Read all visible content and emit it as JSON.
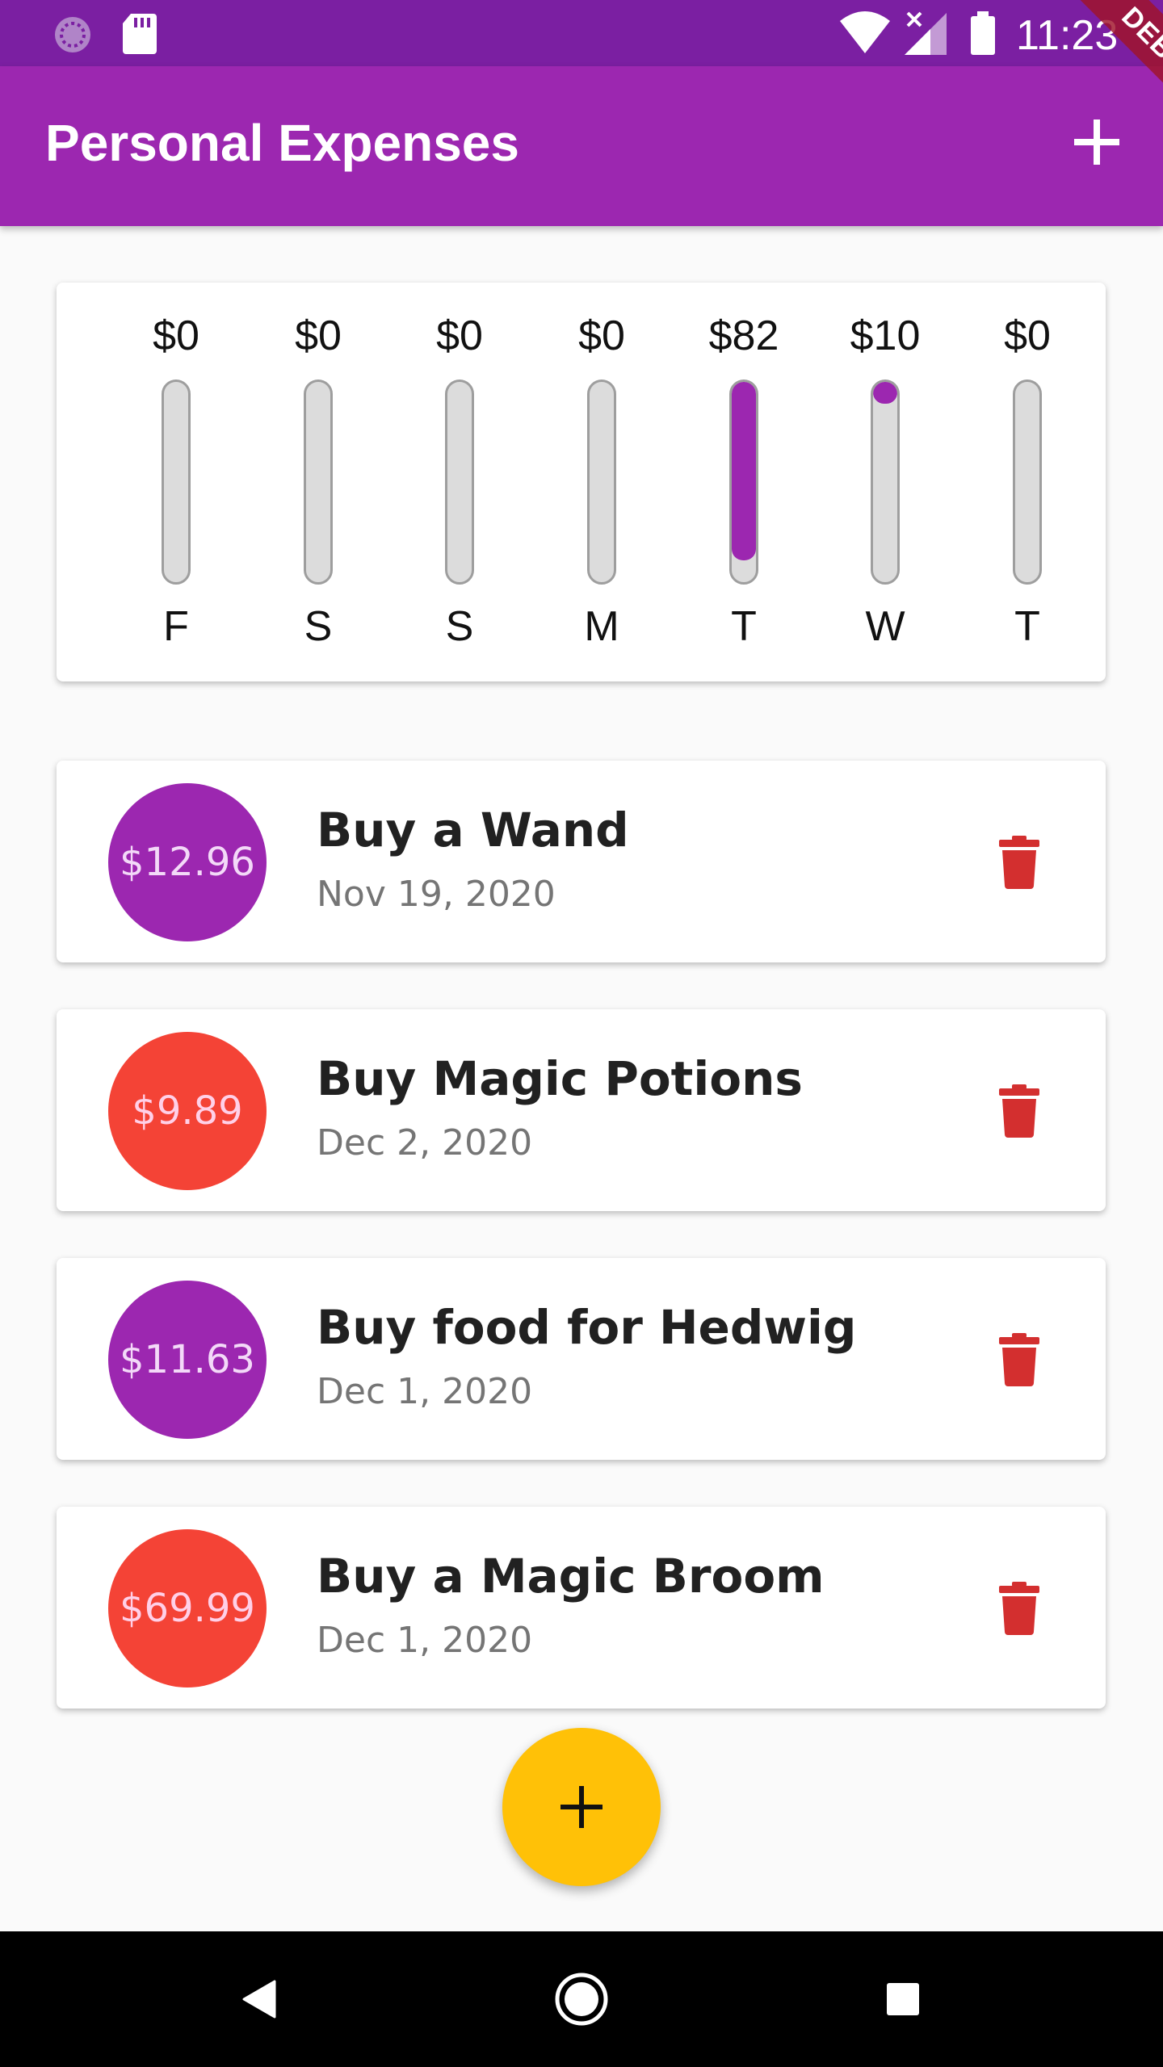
{
  "status_bar": {
    "time": "11:23",
    "icons": [
      "spinner-icon",
      "sd-card-icon",
      "wifi-icon",
      "signal-icon",
      "battery-icon"
    ]
  },
  "app_bar": {
    "title": "Personal Expenses",
    "add_icon": "plus-icon",
    "debug_banner": "DEBUG"
  },
  "colors": {
    "primary": "#9c27b0",
    "primary_dark": "#7b1fa2",
    "accent": "#ffc107",
    "avatar_alt": "#f44336",
    "delete": "#d32f2f"
  },
  "chart": {
    "days": [
      {
        "amount": "$0",
        "label": "F",
        "fill": 0
      },
      {
        "amount": "$0",
        "label": "S",
        "fill": 0
      },
      {
        "amount": "$0",
        "label": "S",
        "fill": 0
      },
      {
        "amount": "$0",
        "label": "M",
        "fill": 0
      },
      {
        "amount": "$82",
        "label": "T",
        "fill": 0.89
      },
      {
        "amount": "$10",
        "label": "W",
        "fill": 0.11
      },
      {
        "amount": "$0",
        "label": "T",
        "fill": 0
      }
    ]
  },
  "transactions": [
    {
      "amount": "$12.96",
      "title": "Buy a Wand",
      "date": "Nov 19, 2020",
      "avatar_color": "#9c27b0",
      "amount_color": "#f3d9f8"
    },
    {
      "amount": "$9.89",
      "title": "Buy Magic Potions",
      "date": "Dec 2, 2020",
      "avatar_color": "#f44336",
      "amount_color": "#ffd0e8"
    },
    {
      "amount": "$11.63",
      "title": "Buy food for Hedwig",
      "date": "Dec 1, 2020",
      "avatar_color": "#9c27b0",
      "amount_color": "#f3d9f8"
    },
    {
      "amount": "$69.99",
      "title": "Buy a Magic Broom",
      "date": "Dec 1, 2020",
      "avatar_color": "#f44336",
      "amount_color": "#ffd0e8"
    }
  ],
  "fab": {
    "icon": "plus-icon"
  },
  "nav_bar": {
    "icons": [
      "back-icon",
      "home-icon",
      "recents-icon"
    ]
  }
}
